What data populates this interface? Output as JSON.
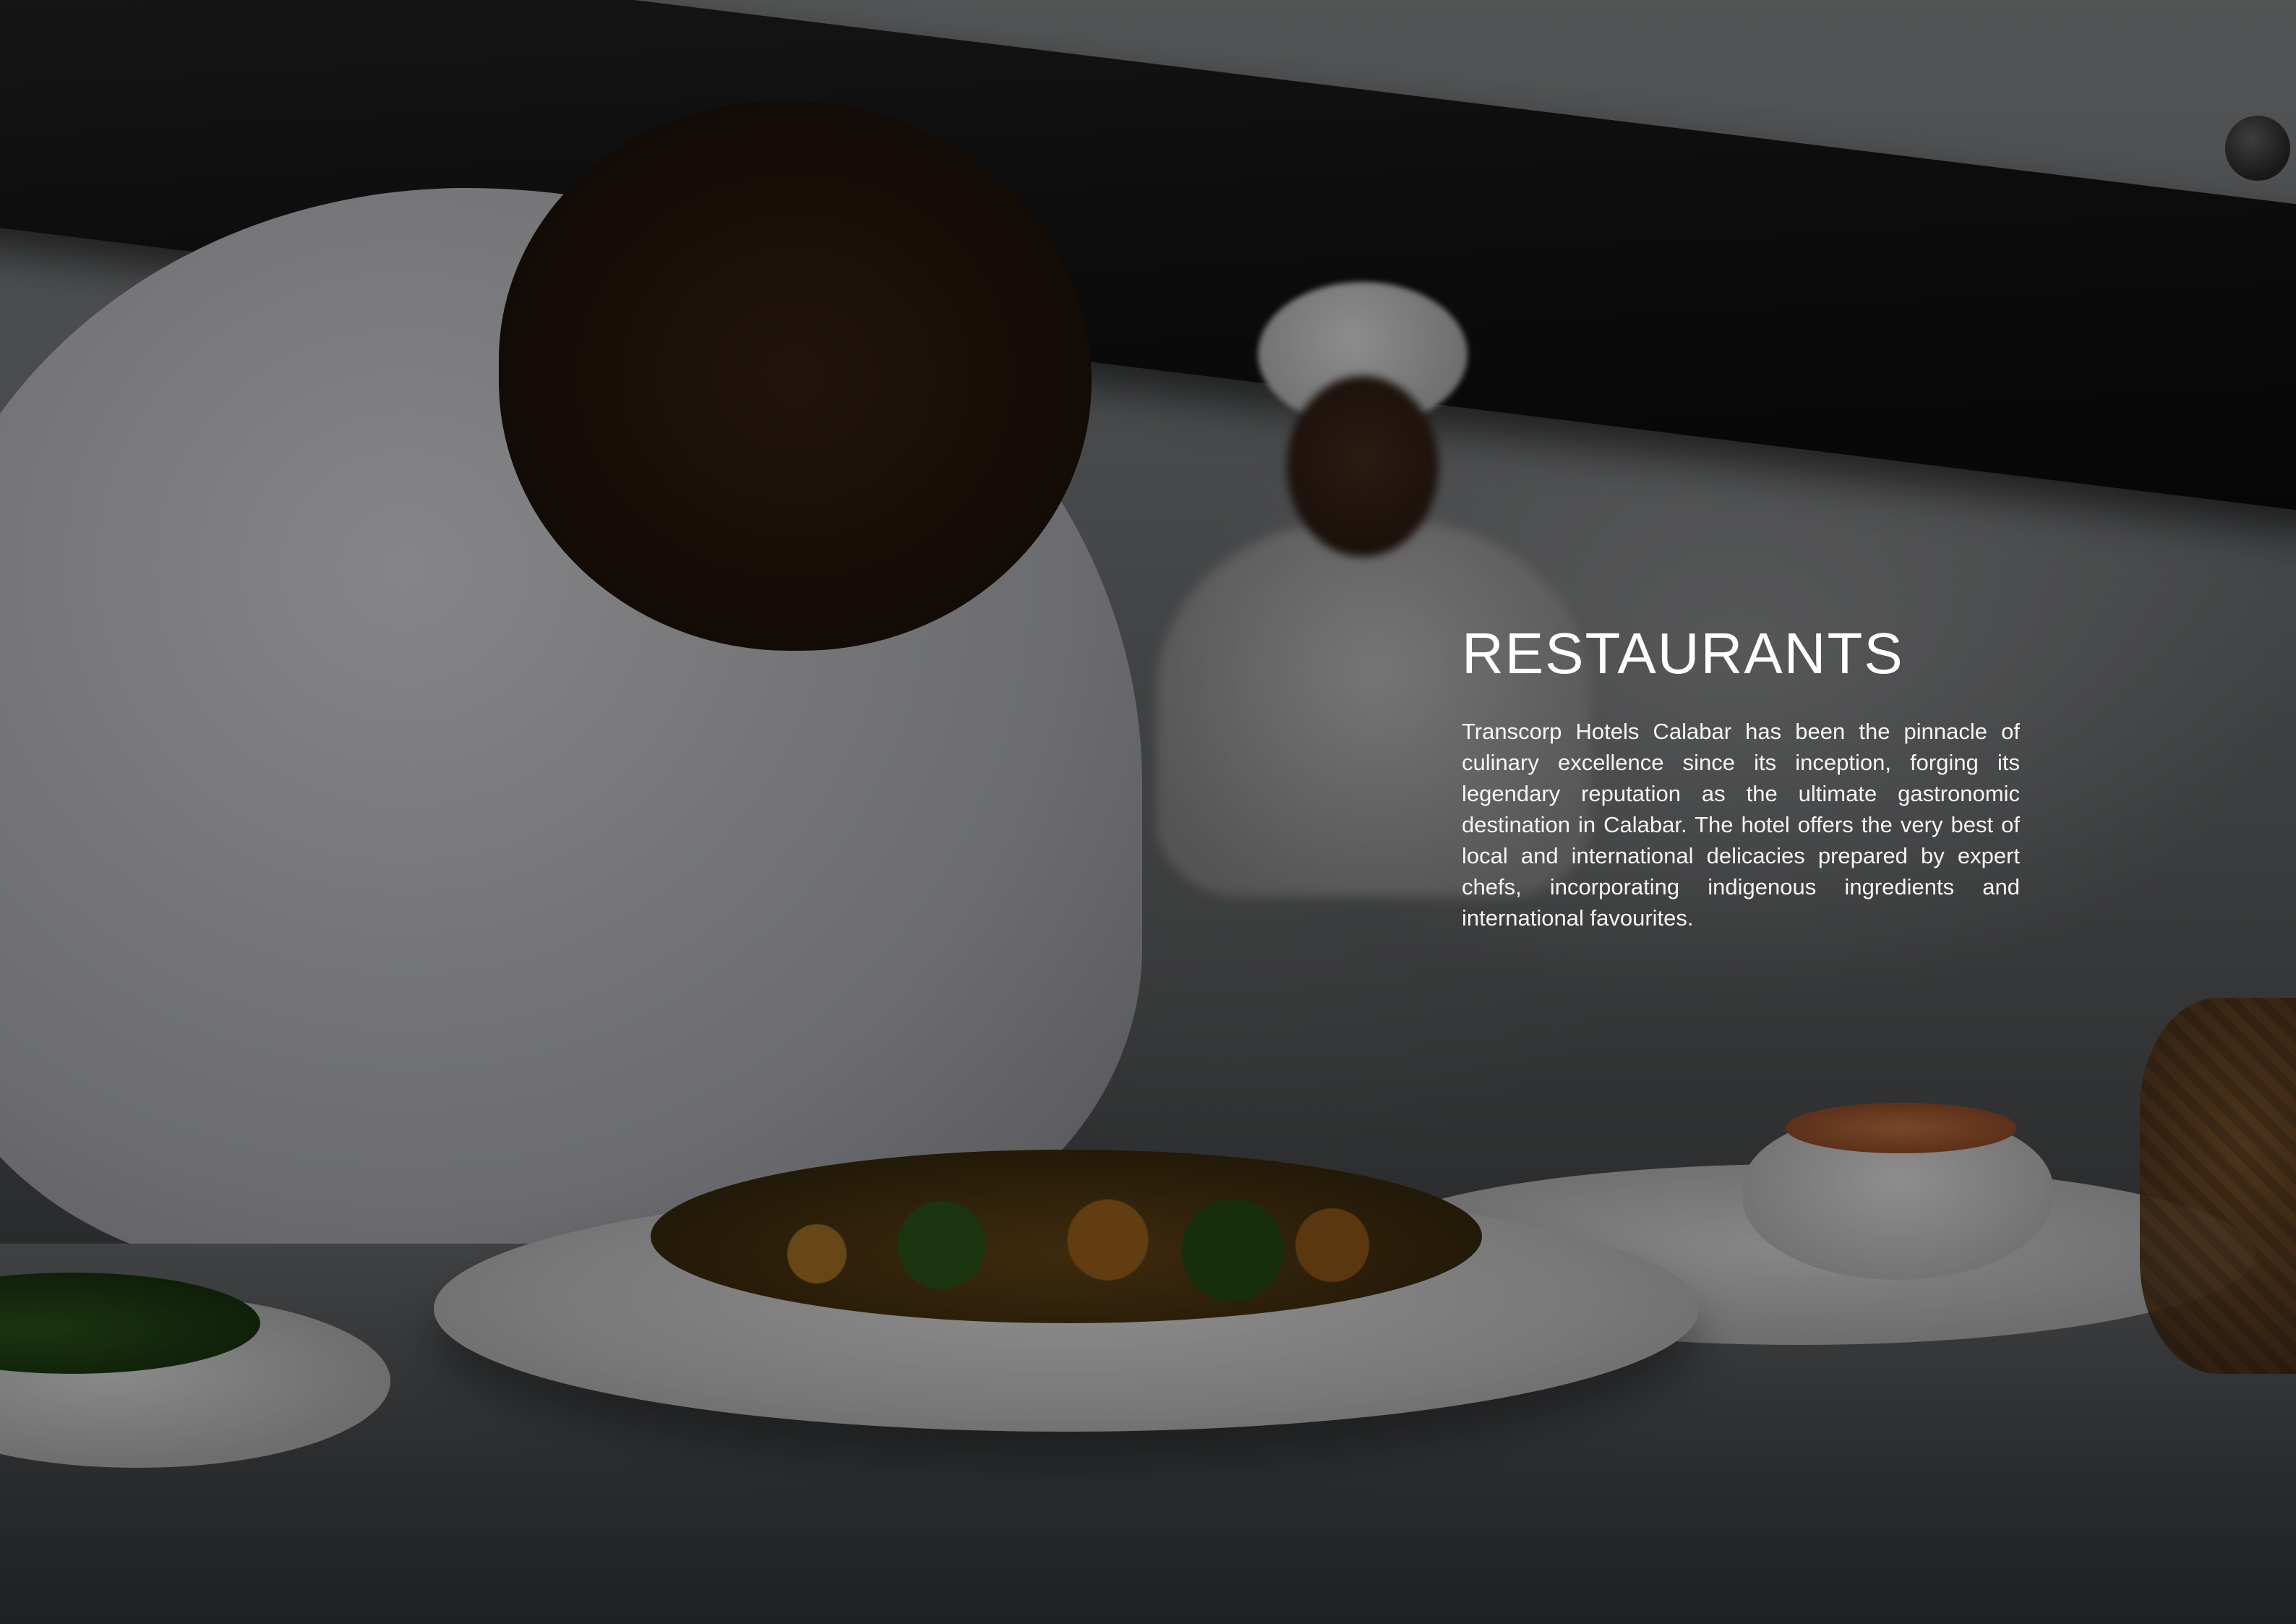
{
  "page": {
    "title": "RESTAURANTS",
    "body": "Transcorp Hotels Calabar has been the pinnacle of culinary excellence since its inception, forging its legendary reputation as the ultimate gastronomic destination in Calabar. The hotel offers the very best of local and international delicacies prepared by expert chefs, incorporating indigenous ingredients and international favourites."
  }
}
